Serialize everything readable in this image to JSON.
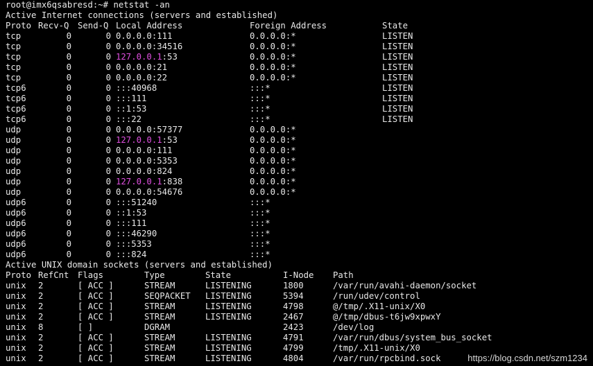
{
  "prompt_line": "root@imx6qsabresd:~# netstat -an",
  "inet_title": "Active Internet connections (servers and established)",
  "inet_headers": [
    "Proto",
    "Recv-Q",
    "Send-Q",
    "Local Address",
    "Foreign Address",
    "State"
  ],
  "inet_rows": [
    {
      "proto": "tcp",
      "recv": "0",
      "send": "0",
      "local_ip": "0.0.0.0",
      "local_port": ":111",
      "foreign": "0.0.0.0:*",
      "state": "LISTEN"
    },
    {
      "proto": "tcp",
      "recv": "0",
      "send": "0",
      "local_ip": "0.0.0.0",
      "local_port": ":34516",
      "foreign": "0.0.0.0:*",
      "state": "LISTEN"
    },
    {
      "proto": "tcp",
      "recv": "0",
      "send": "0",
      "local_ip": "127.0.0.1",
      "local_port": ":53",
      "foreign": "0.0.0.0:*",
      "state": "LISTEN",
      "highlight": true
    },
    {
      "proto": "tcp",
      "recv": "0",
      "send": "0",
      "local_ip": "0.0.0.0",
      "local_port": ":21",
      "foreign": "0.0.0.0:*",
      "state": "LISTEN"
    },
    {
      "proto": "tcp",
      "recv": "0",
      "send": "0",
      "local_ip": "0.0.0.0",
      "local_port": ":22",
      "foreign": "0.0.0.0:*",
      "state": "LISTEN"
    },
    {
      "proto": "tcp6",
      "recv": "0",
      "send": "0",
      "local_ip": "::",
      "local_port": ":40968",
      "foreign": ":::*",
      "state": "LISTEN"
    },
    {
      "proto": "tcp6",
      "recv": "0",
      "send": "0",
      "local_ip": "::",
      "local_port": ":111",
      "foreign": ":::*",
      "state": "LISTEN"
    },
    {
      "proto": "tcp6",
      "recv": "0",
      "send": "0",
      "local_ip": "::1",
      "local_port": ":53",
      "foreign": ":::*",
      "state": "LISTEN"
    },
    {
      "proto": "tcp6",
      "recv": "0",
      "send": "0",
      "local_ip": "::",
      "local_port": ":22",
      "foreign": ":::*",
      "state": "LISTEN"
    },
    {
      "proto": "udp",
      "recv": "0",
      "send": "0",
      "local_ip": "0.0.0.0",
      "local_port": ":57377",
      "foreign": "0.0.0.0:*",
      "state": ""
    },
    {
      "proto": "udp",
      "recv": "0",
      "send": "0",
      "local_ip": "127.0.0.1",
      "local_port": ":53",
      "foreign": "0.0.0.0:*",
      "state": "",
      "highlight": true
    },
    {
      "proto": "udp",
      "recv": "0",
      "send": "0",
      "local_ip": "0.0.0.0",
      "local_port": ":111",
      "foreign": "0.0.0.0:*",
      "state": ""
    },
    {
      "proto": "udp",
      "recv": "0",
      "send": "0",
      "local_ip": "0.0.0.0",
      "local_port": ":5353",
      "foreign": "0.0.0.0:*",
      "state": ""
    },
    {
      "proto": "udp",
      "recv": "0",
      "send": "0",
      "local_ip": "0.0.0.0",
      "local_port": ":824",
      "foreign": "0.0.0.0:*",
      "state": ""
    },
    {
      "proto": "udp",
      "recv": "0",
      "send": "0",
      "local_ip": "127.0.0.1",
      "local_port": ":838",
      "foreign": "0.0.0.0:*",
      "state": "",
      "highlight": true
    },
    {
      "proto": "udp",
      "recv": "0",
      "send": "0",
      "local_ip": "0.0.0.0",
      "local_port": ":54676",
      "foreign": "0.0.0.0:*",
      "state": ""
    },
    {
      "proto": "udp6",
      "recv": "0",
      "send": "0",
      "local_ip": "::",
      "local_port": ":51240",
      "foreign": ":::*",
      "state": ""
    },
    {
      "proto": "udp6",
      "recv": "0",
      "send": "0",
      "local_ip": "::1",
      "local_port": ":53",
      "foreign": ":::*",
      "state": ""
    },
    {
      "proto": "udp6",
      "recv": "0",
      "send": "0",
      "local_ip": "::",
      "local_port": ":111",
      "foreign": ":::*",
      "state": ""
    },
    {
      "proto": "udp6",
      "recv": "0",
      "send": "0",
      "local_ip": "::",
      "local_port": ":46290",
      "foreign": ":::*",
      "state": ""
    },
    {
      "proto": "udp6",
      "recv": "0",
      "send": "0",
      "local_ip": "::",
      "local_port": ":5353",
      "foreign": ":::*",
      "state": ""
    },
    {
      "proto": "udp6",
      "recv": "0",
      "send": "0",
      "local_ip": "::",
      "local_port": ":824",
      "foreign": ":::*",
      "state": ""
    }
  ],
  "unix_title": "Active UNIX domain sockets (servers and established)",
  "unix_headers": [
    "Proto",
    "RefCnt",
    "Flags",
    "Type",
    "State",
    "I-Node",
    "Path"
  ],
  "unix_rows": [
    {
      "proto": "unix",
      "refcnt": "2",
      "flags": "[ ACC ]",
      "type": "STREAM",
      "state": "LISTENING",
      "inode": "1800",
      "path": "/var/run/avahi-daemon/socket"
    },
    {
      "proto": "unix",
      "refcnt": "2",
      "flags": "[ ACC ]",
      "type": "SEQPACKET",
      "state": "LISTENING",
      "inode": "5394",
      "path": "/run/udev/control"
    },
    {
      "proto": "unix",
      "refcnt": "2",
      "flags": "[ ACC ]",
      "type": "STREAM",
      "state": "LISTENING",
      "inode": "4798",
      "path": "@/tmp/.X11-unix/X0"
    },
    {
      "proto": "unix",
      "refcnt": "2",
      "flags": "[ ACC ]",
      "type": "STREAM",
      "state": "LISTENING",
      "inode": "2467",
      "path": "@/tmp/dbus-t6jw9xpwxY"
    },
    {
      "proto": "unix",
      "refcnt": "8",
      "flags": "[ ]",
      "type": "DGRAM",
      "state": "",
      "inode": "2423",
      "path": "/dev/log"
    },
    {
      "proto": "unix",
      "refcnt": "2",
      "flags": "[ ACC ]",
      "type": "STREAM",
      "state": "LISTENING",
      "inode": "4791",
      "path": "/var/run/dbus/system_bus_socket"
    },
    {
      "proto": "unix",
      "refcnt": "2",
      "flags": "[ ACC ]",
      "type": "STREAM",
      "state": "LISTENING",
      "inode": "4799",
      "path": "/tmp/.X11-unix/X0"
    },
    {
      "proto": "unix",
      "refcnt": "2",
      "flags": "[ ACC ]",
      "type": "STREAM",
      "state": "LISTENING",
      "inode": "4804",
      "path": "/var/run/rpcbind.sock"
    }
  ],
  "watermark": "https://blog.csdn.net/szm1234",
  "colors": {
    "background": "#000000",
    "text": "#e8e8e8",
    "highlight": "#e04fe0"
  }
}
